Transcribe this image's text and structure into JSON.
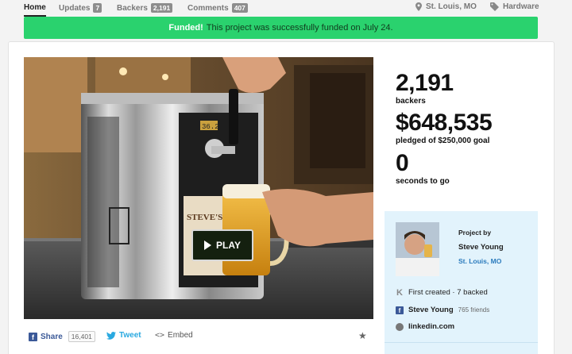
{
  "nav": {
    "home": "Home",
    "updates": {
      "label": "Updates",
      "count": "7"
    },
    "backers": {
      "label": "Backers",
      "count": "2,191"
    },
    "comments": {
      "label": "Comments",
      "count": "407"
    },
    "location": "St. Louis, MO",
    "category": "Hardware"
  },
  "banner": {
    "status": "Funded!",
    "message": "This project was successfully funded on July 24."
  },
  "video": {
    "play_label": "PLAY",
    "thermometer_display": "36.2"
  },
  "share": {
    "facebook_label": "Share",
    "facebook_count": "16,401",
    "twitter_label": "Tweet",
    "embed_label": "Embed"
  },
  "stats": {
    "backers_value": "2,191",
    "backers_label": "backers",
    "pledged_value": "$648,535",
    "pledged_label": "pledged of $250,000 goal",
    "time_value": "0",
    "time_label": "seconds to go"
  },
  "creator": {
    "project_by": "Project by",
    "name": "Steve Young",
    "location": "St. Louis, MO",
    "kickstarter_line": "First created · 7 backed",
    "facebook_name": "Steve Young",
    "facebook_friends": "765 friends",
    "website": "linkedin.com"
  },
  "colors": {
    "banner_green": "#2ad26e",
    "link_blue": "#2b7bbd",
    "facebook_blue": "#3b5998",
    "twitter_blue": "#2aa9e0",
    "creator_bg": "#e2f3fc"
  }
}
